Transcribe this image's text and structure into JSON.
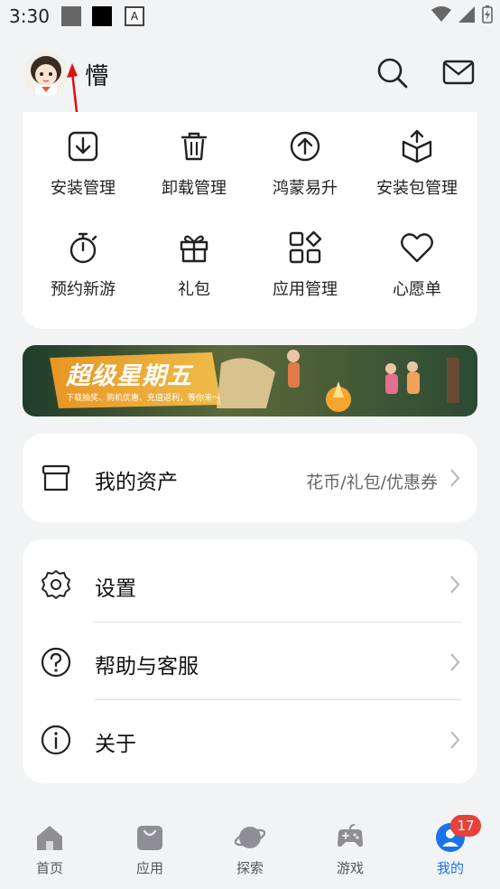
{
  "status_bar": {
    "time": "3:30"
  },
  "header": {
    "username": "懵"
  },
  "quick_grid": [
    {
      "label": "安装管理",
      "icon": "download-box-icon"
    },
    {
      "label": "卸载管理",
      "icon": "trash-icon"
    },
    {
      "label": "鸿蒙易升",
      "icon": "upgrade-arrow-icon"
    },
    {
      "label": "安装包管理",
      "icon": "package-icon"
    },
    {
      "label": "预约新游",
      "icon": "stopwatch-icon"
    },
    {
      "label": "礼包",
      "icon": "gift-icon"
    },
    {
      "label": "应用管理",
      "icon": "apps-grid-icon"
    },
    {
      "label": "心愿单",
      "icon": "heart-icon"
    }
  ],
  "banner": {
    "title": "超级星期五",
    "subtitle": "下载抽奖、购机优惠、充值返利，等你来～"
  },
  "assets": {
    "label": "我的资产",
    "sub": "花币/礼包/优惠券"
  },
  "settings_list": [
    {
      "label": "设置",
      "icon": "gear-icon"
    },
    {
      "label": "帮助与客服",
      "icon": "help-icon"
    },
    {
      "label": "关于",
      "icon": "info-icon"
    }
  ],
  "bottom_nav": [
    {
      "label": "首页",
      "icon": "home-icon"
    },
    {
      "label": "应用",
      "icon": "bag-icon"
    },
    {
      "label": "探索",
      "icon": "planet-icon"
    },
    {
      "label": "游戏",
      "icon": "gamepad-icon"
    },
    {
      "label": "我的",
      "icon": "user-icon",
      "active": true
    }
  ],
  "badge_count": "17",
  "colors": {
    "accent": "#1a73e8",
    "badge": "#e8403a",
    "background": "#f1f3f5"
  }
}
